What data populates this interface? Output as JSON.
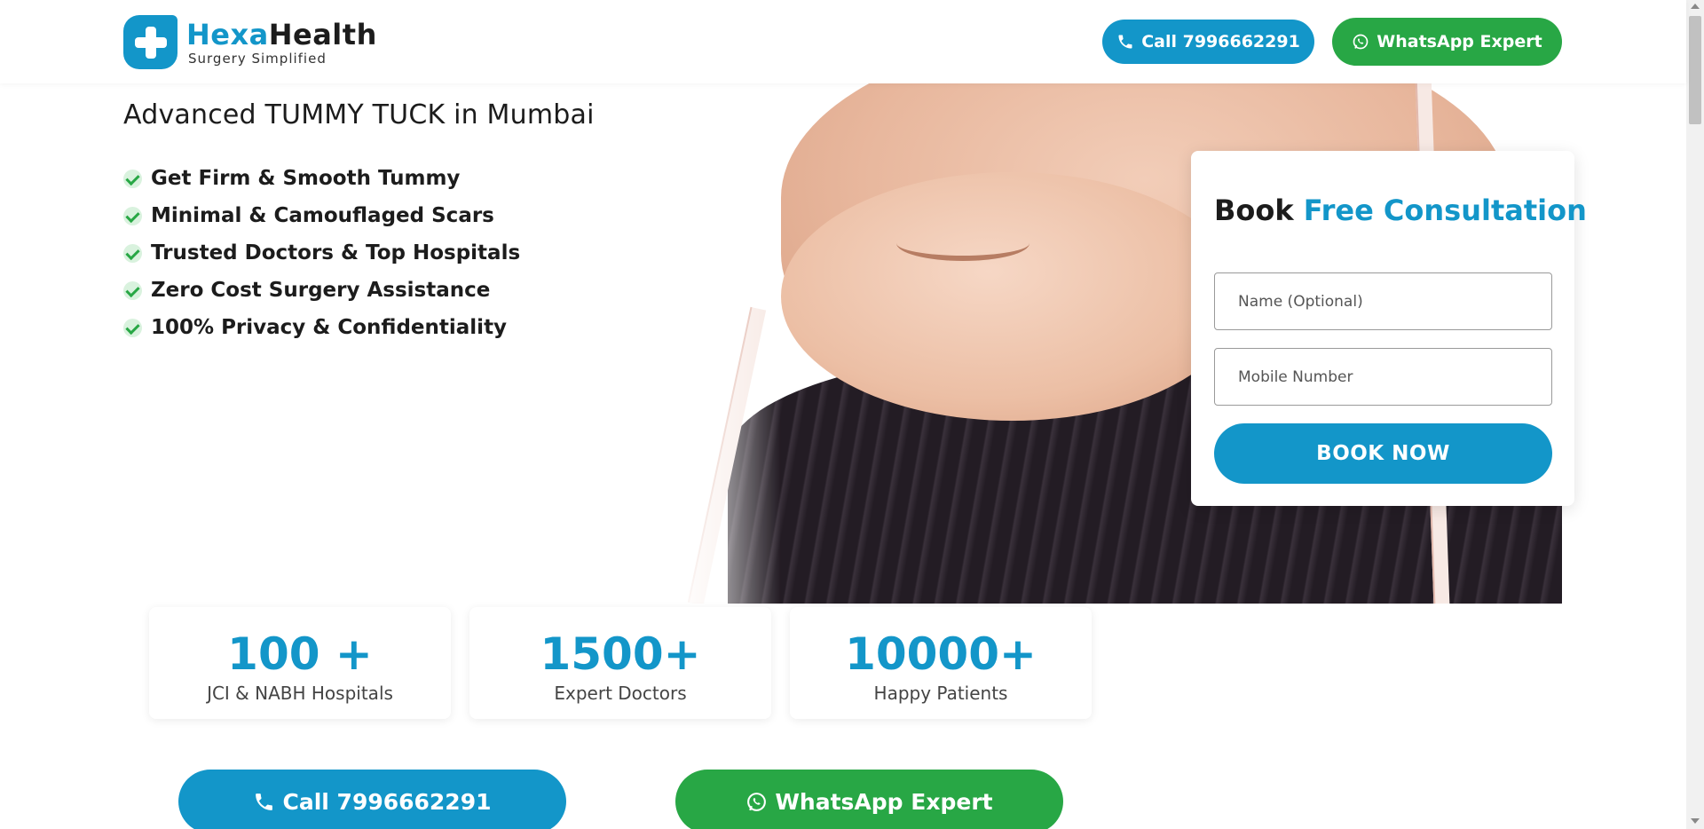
{
  "header": {
    "logo": {
      "brand_part1": "Hexa",
      "brand_part2": "Health",
      "tagline": "Surgery Simplified"
    },
    "call_button": {
      "label": "Call 7996662291",
      "icon": "phone-icon"
    },
    "whatsapp_button": {
      "label": "WhatsApp Expert",
      "icon": "whatsapp-icon"
    }
  },
  "hero": {
    "title": "Advanced TUMMY TUCK in Mumbai",
    "benefits": [
      "Get Firm & Smooth Tummy",
      "Minimal & Camouflaged Scars",
      "Trusted Doctors & Top Hospitals",
      "Zero Cost Surgery Assistance",
      "100% Privacy & Confidentiality"
    ],
    "image_alt": "tummy-tuck-photo"
  },
  "form": {
    "title_part1": "Book",
    "title_part2": "Free Consultation",
    "name_placeholder": "Name (Optional)",
    "mobile_placeholder": "Mobile Number",
    "submit_label": "BOOK NOW"
  },
  "stats": [
    {
      "value": "100 +",
      "label": "JCI & NABH Hospitals"
    },
    {
      "value": "1500+",
      "label": "Expert Doctors"
    },
    {
      "value": "10000+",
      "label": "Happy Patients"
    }
  ],
  "bottom_cta": {
    "call_label": "Call 7996662291",
    "whatsapp_label": "WhatsApp Expert"
  },
  "colors": {
    "brand_blue": "#1396c9",
    "whatsapp_green": "#28a745",
    "text_dark": "#1c1c1c"
  }
}
